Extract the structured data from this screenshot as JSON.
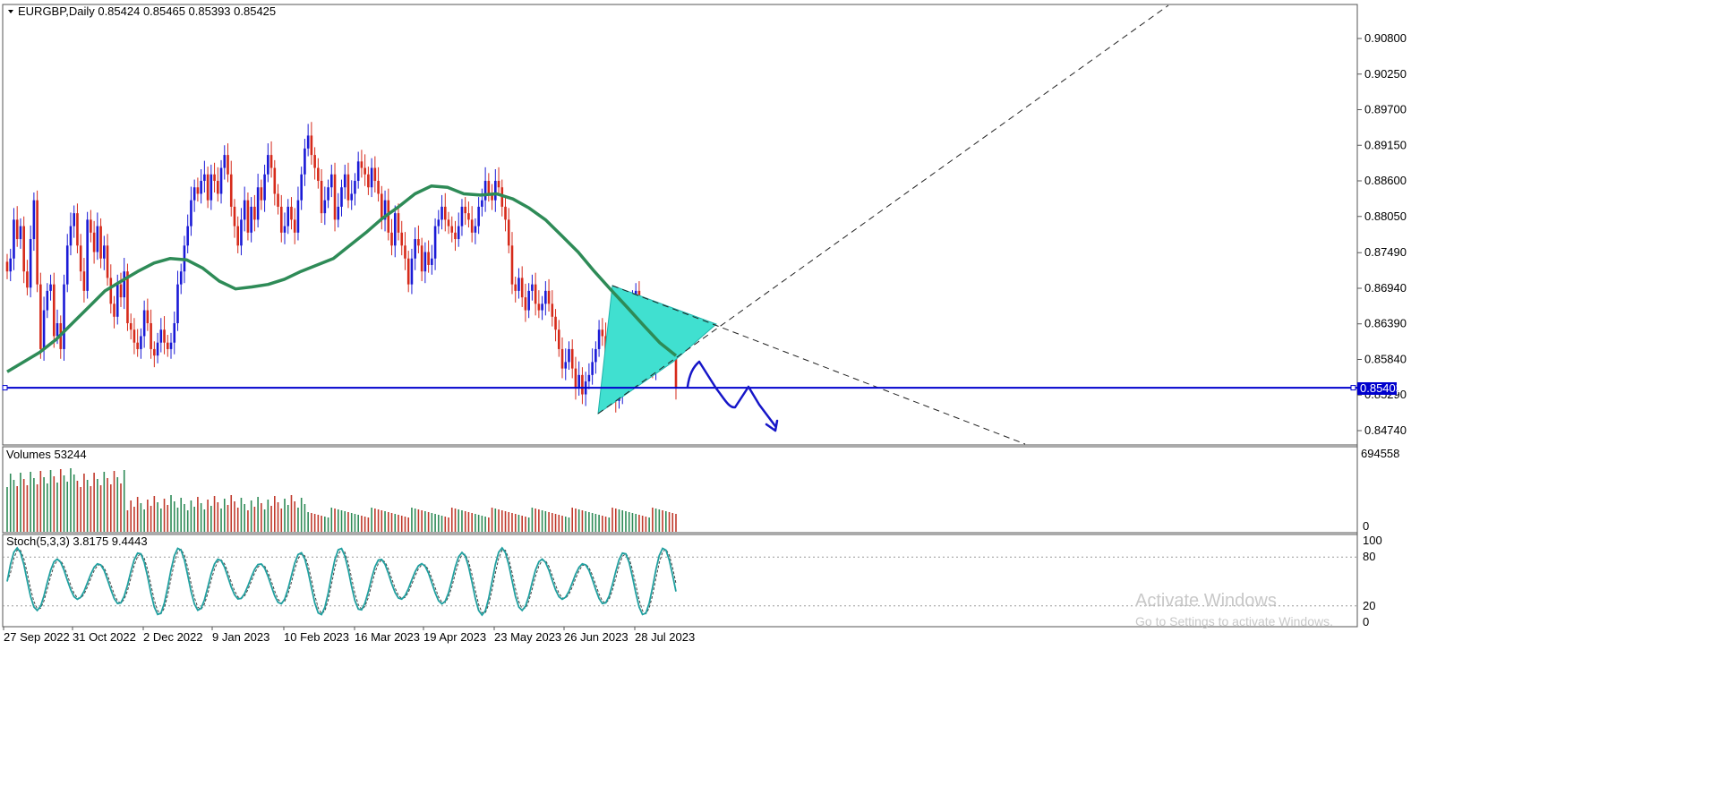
{
  "chart_data": {
    "type": "candlestick",
    "symbol_header": "EURGBP,Daily  0.85424 0.85465 0.85393 0.85425",
    "price_axis": {
      "ticks": [
        "0.90800",
        "0.90250",
        "0.89700",
        "0.89150",
        "0.88600",
        "0.88050",
        "0.87490",
        "0.86940",
        "0.86390",
        "0.85840",
        "0.85290",
        "0.84740"
      ],
      "ylim": [
        0.8445,
        0.9125
      ],
      "current_price": "0.85403"
    },
    "time_axis": {
      "ticks": [
        "27 Sep 2022",
        "31 Oct 2022",
        "2 Dec 2022",
        "9 Jan 2023",
        "10 Feb 2023",
        "16 Mar 2023",
        "19 Apr 2023",
        "23 May 2023",
        "26 Jun 2023",
        "28 Jul 2023"
      ]
    },
    "close_path": [
      0.872,
      0.874,
      0.88,
      0.877,
      0.879,
      0.872,
      0.8695,
      0.877,
      0.883,
      0.87,
      0.86,
      0.866,
      0.869,
      0.87,
      0.862,
      0.864,
      0.86,
      0.87,
      0.876,
      0.879,
      0.881,
      0.876,
      0.872,
      0.869,
      0.88,
      0.878,
      0.875,
      0.879,
      0.874,
      0.876,
      0.871,
      0.867,
      0.865,
      0.87,
      0.868,
      0.872,
      0.864,
      0.863,
      0.861,
      0.86,
      0.862,
      0.866,
      0.864,
      0.86,
      0.859,
      0.861,
      0.863,
      0.861,
      0.86,
      0.861,
      0.864,
      0.87,
      0.872,
      0.876,
      0.879,
      0.883,
      0.885,
      0.884,
      0.886,
      0.887,
      0.883,
      0.887,
      0.886,
      0.884,
      0.888,
      0.89,
      0.887,
      0.882,
      0.879,
      0.876,
      0.88,
      0.883,
      0.878,
      0.882,
      0.88,
      0.885,
      0.883,
      0.887,
      0.89,
      0.888,
      0.884,
      0.882,
      0.878,
      0.879,
      0.882,
      0.88,
      0.878,
      0.883,
      0.887,
      0.891,
      0.893,
      0.89,
      0.888,
      0.886,
      0.881,
      0.883,
      0.885,
      0.887,
      0.88,
      0.882,
      0.885,
      0.887,
      0.883,
      0.884,
      0.886,
      0.889,
      0.888,
      0.887,
      0.885,
      0.888,
      0.886,
      0.884,
      0.88,
      0.883,
      0.878,
      0.876,
      0.881,
      0.878,
      0.876,
      0.874,
      0.87,
      0.874,
      0.877,
      0.876,
      0.872,
      0.875,
      0.873,
      0.874,
      0.879,
      0.88,
      0.882,
      0.88,
      0.879,
      0.878,
      0.877,
      0.879,
      0.882,
      0.881,
      0.88,
      0.878,
      0.879,
      0.882,
      0.883,
      0.886,
      0.884,
      0.883,
      0.886,
      0.885,
      0.882,
      0.88,
      0.876,
      0.87,
      0.869,
      0.871,
      0.868,
      0.866,
      0.869,
      0.87,
      0.867,
      0.866,
      0.867,
      0.869,
      0.867,
      0.865,
      0.863,
      0.86,
      0.857,
      0.858,
      0.86,
      0.857,
      0.854,
      0.856,
      0.853,
      0.855,
      0.856,
      0.858,
      0.86,
      0.863,
      0.862,
      0.857,
      0.858,
      0.855,
      0.852,
      0.853,
      0.857,
      0.86,
      0.864,
      0.867,
      0.869,
      0.865,
      0.862,
      0.859,
      0.861,
      0.857,
      0.859,
      0.864,
      0.863,
      0.864,
      0.862,
      0.86,
      0.854
    ],
    "moving_average_path": [
      0.8565,
      0.858,
      0.8595,
      0.8615,
      0.864,
      0.8665,
      0.869,
      0.8705,
      0.872,
      0.8733,
      0.874,
      0.8738,
      0.8725,
      0.8705,
      0.8693,
      0.8696,
      0.87,
      0.8708,
      0.872,
      0.873,
      0.874,
      0.876,
      0.878,
      0.8802,
      0.882,
      0.884,
      0.8852,
      0.885,
      0.884,
      0.8838,
      0.884,
      0.8832,
      0.8818,
      0.88,
      0.8775,
      0.875,
      0.872,
      0.8692,
      0.8665,
      0.8637,
      0.861,
      0.859
    ],
    "volumes": {
      "label": "Volumes 53244",
      "axis_max": "694558",
      "axis_min": "0"
    },
    "stochastic": {
      "label": "Stoch(5,3,3) 3.8175 9.4443",
      "levels": [
        "100",
        "80",
        "20",
        "0"
      ]
    }
  },
  "watermark": {
    "title": "Activate Windows",
    "subtitle": "Go to Settings to activate Windows."
  },
  "colors": {
    "up": "#1a1ad6",
    "down": "#d62a1a",
    "ma": "#2e8b57",
    "triangle": "#40e0d0",
    "hline": "#0000cd",
    "stoch": "#20a0a0"
  }
}
